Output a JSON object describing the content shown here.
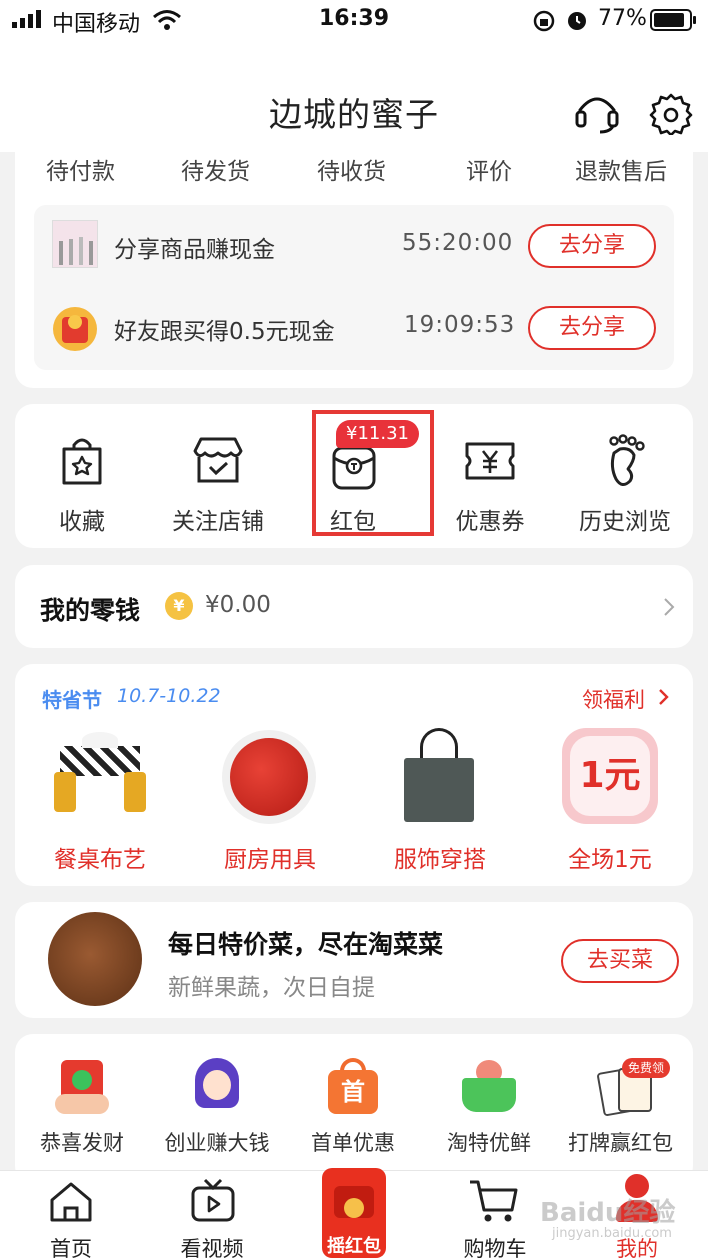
{
  "status_bar": {
    "carrier": "中国移动",
    "time": "16:39",
    "battery": "77%"
  },
  "header": {
    "title": "边城的蜜子"
  },
  "order_tabs": [
    "待付款",
    "待发货",
    "待收货",
    "评价",
    "退款售后"
  ],
  "share_tasks": [
    {
      "text": "分享商品赚现金",
      "timer": "55:20:00",
      "button": "去分享"
    },
    {
      "text": "好友跟买得0.5元现金",
      "timer": "19:09:53",
      "button": "去分享"
    }
  ],
  "quick_icons": [
    {
      "label": "收藏",
      "icon": "favorites-bag-icon"
    },
    {
      "label": "关注店铺",
      "icon": "shop-icon"
    },
    {
      "label": "红包",
      "icon": "red-packet-icon",
      "badge": "¥11.31"
    },
    {
      "label": "优惠券",
      "icon": "coupon-icon"
    },
    {
      "label": "历史浏览",
      "icon": "footprint-icon"
    }
  ],
  "wallet": {
    "title": "我的零钱",
    "amount": "¥0.00",
    "coin_symbol": "¥"
  },
  "festival": {
    "title": "特省节",
    "dates": "10.7-10.22",
    "link": "领福利",
    "items": [
      "餐桌布艺",
      "厨房用具",
      "服饰穿搭",
      "全场1元"
    ],
    "one_yuan_text": "1元"
  },
  "grocery": {
    "title": "每日特价菜，尽在淘菜菜",
    "subtitle": "新鲜果蔬，次日自提",
    "button": "去买菜"
  },
  "promos": [
    {
      "label": "恭喜发财"
    },
    {
      "label": "创业赚大钱"
    },
    {
      "label": "首单优惠",
      "icon_text": "首"
    },
    {
      "label": "淘特优鲜"
    },
    {
      "label": "打牌赢红包",
      "badge": "免费领"
    }
  ],
  "tabbar": {
    "items": [
      "首页",
      "看视频",
      "摇红包",
      "购物车",
      "我的"
    ],
    "center_text": "摇红包",
    "watermark": "Baidu经验",
    "watermark_url": "jingyan.baidu.com"
  },
  "colors": {
    "accent": "#e0302a",
    "festival_blue": "#4a8cf0",
    "background": "#f2f2f2"
  }
}
